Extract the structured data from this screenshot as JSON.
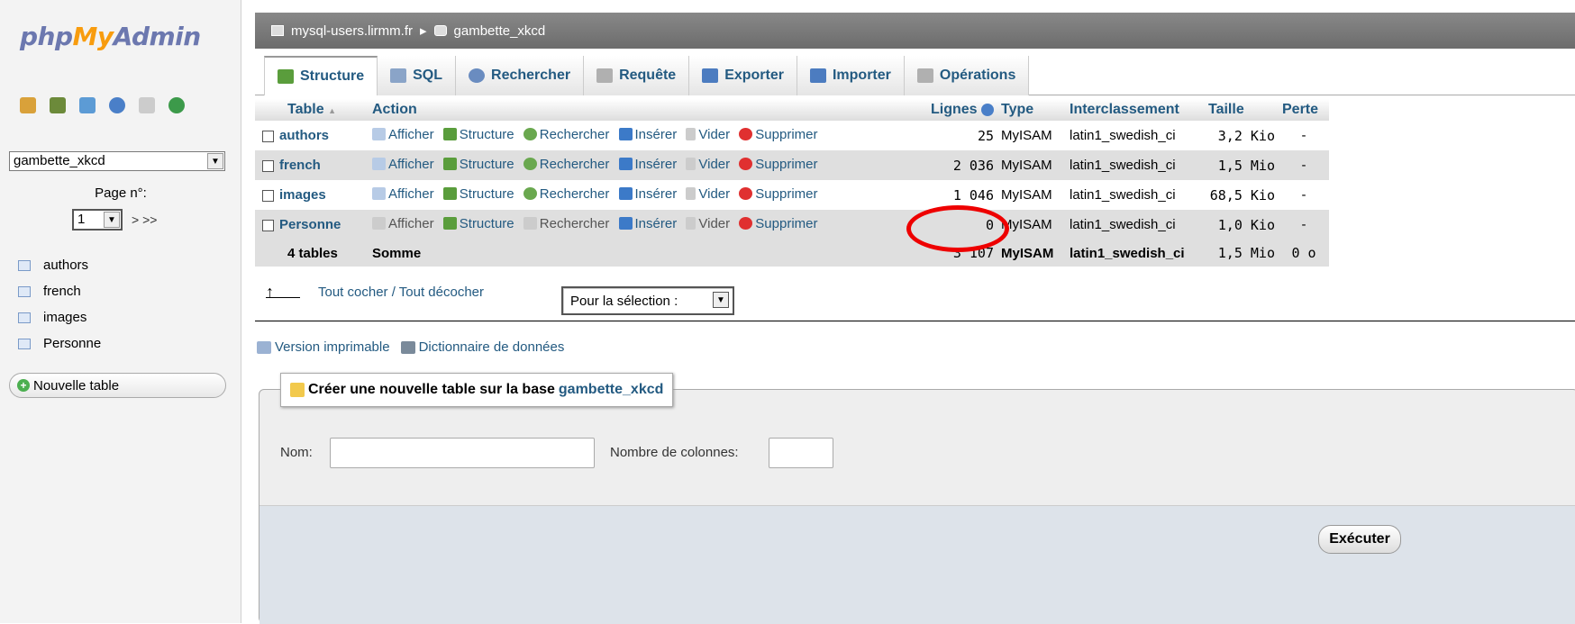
{
  "logo": {
    "php": "php",
    "my": "My",
    "admin": "Admin"
  },
  "sidebar": {
    "quick_icons": [
      "home-icon",
      "exit-icon",
      "query-icon",
      "help-icon",
      "docs-icon",
      "reload-icon"
    ],
    "db_select": "gambette_xkcd",
    "page_label": "Page n°:",
    "page_value": "1",
    "page_nav": "> >>",
    "tables": [
      "authors",
      "french",
      "images",
      "Personne"
    ],
    "new_table": "Nouvelle table"
  },
  "breadcrumb": {
    "server": "mysql-users.lirmm.fr",
    "sep": "▸",
    "db": "gambette_xkcd"
  },
  "tabs": [
    {
      "label": "Structure",
      "icon": "structure-icon",
      "color": "#5a9d3c"
    },
    {
      "label": "SQL",
      "icon": "sql-icon",
      "color": "#8aa4c8"
    },
    {
      "label": "Rechercher",
      "icon": "search-icon",
      "color": "#6a8cc0"
    },
    {
      "label": "Requête",
      "icon": "query-icon",
      "color": "#b0b0b0"
    },
    {
      "label": "Exporter",
      "icon": "export-icon",
      "color": "#4c7cc0"
    },
    {
      "label": "Importer",
      "icon": "import-icon",
      "color": "#4c7cc0"
    },
    {
      "label": "Opérations",
      "icon": "operations-icon",
      "color": "#b0b0b0"
    }
  ],
  "table": {
    "headers": {
      "table": "Table",
      "sort": "▲",
      "action": "Action",
      "lignes": "Lignes",
      "type": "Type",
      "interclassement": "Interclassement",
      "taille": "Taille",
      "perte": "Perte"
    },
    "actions": {
      "afficher": "Afficher",
      "structure": "Structure",
      "rechercher": "Rechercher",
      "inserer": "Insérer",
      "vider": "Vider",
      "supprimer": "Supprimer"
    },
    "rows": [
      {
        "name": "authors",
        "lignes": "25",
        "type": "MyISAM",
        "coll": "latin1_swedish_ci",
        "taille": "3,2 Kio",
        "perte": "-"
      },
      {
        "name": "french",
        "lignes": "2 036",
        "type": "MyISAM",
        "coll": "latin1_swedish_ci",
        "taille": "1,5 Mio",
        "perte": "-"
      },
      {
        "name": "images",
        "lignes": "1 046",
        "type": "MyISAM",
        "coll": "latin1_swedish_ci",
        "taille": "68,5 Kio",
        "perte": "-"
      },
      {
        "name": "Personne",
        "lignes": "0",
        "type": "MyISAM",
        "coll": "latin1_swedish_ci",
        "taille": "1,0 Kio",
        "perte": "-"
      }
    ],
    "footer": {
      "count": "4 tables",
      "label": "Somme",
      "lignes": "3 107",
      "type": "MyISAM",
      "coll": "latin1_swedish_ci",
      "taille": "1,5 Mio",
      "perte": "0 o"
    }
  },
  "check_all": "Tout cocher / Tout décocher",
  "selection": "Pour la sélection :",
  "links": {
    "print": "Version imprimable",
    "dict": "Dictionnaire de données"
  },
  "create": {
    "legend": "Créer une nouvelle table sur la base",
    "db": "gambette_xkcd",
    "nom_label": "Nom:",
    "cols_label": "Nombre de colonnes:",
    "exec": "Exécuter"
  }
}
